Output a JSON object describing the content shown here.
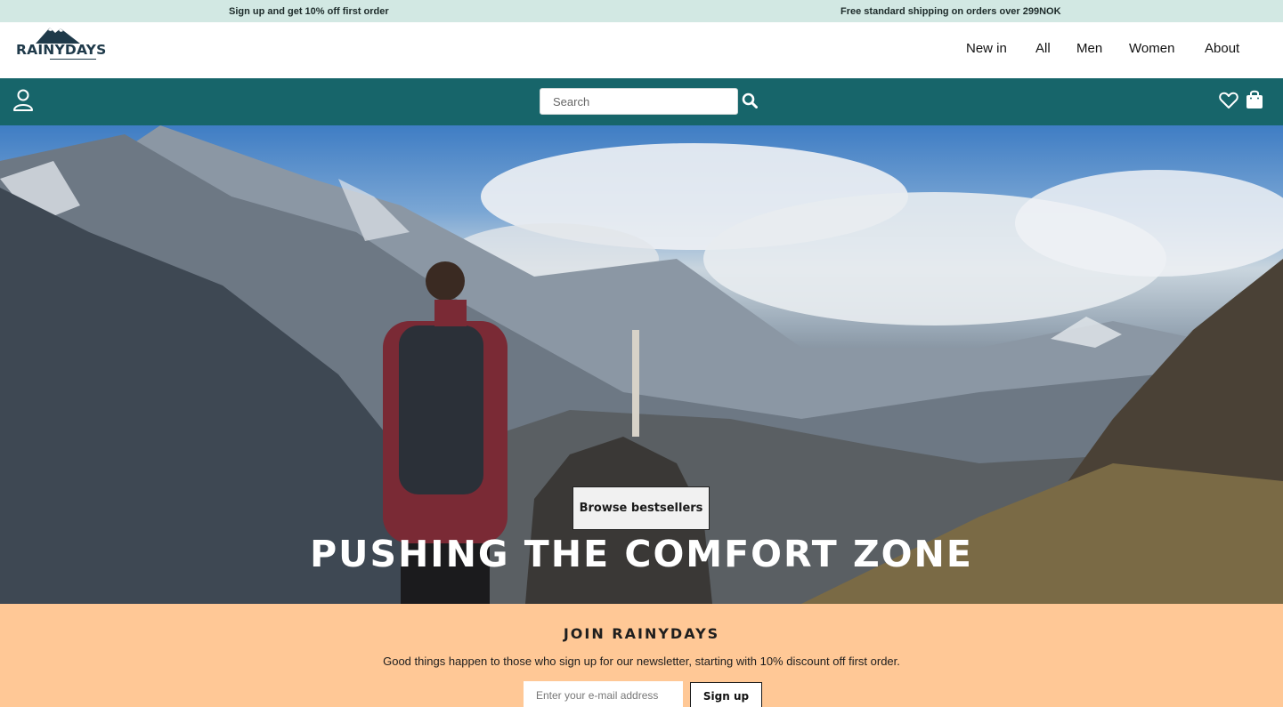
{
  "promo": {
    "left": "Sign up and get 10% off first order",
    "right": "Free standard shipping on orders over 299NOK"
  },
  "header": {
    "logo_text": "RAINYDAYS",
    "nav": [
      "New in",
      "All",
      "Men",
      "Women",
      "About"
    ]
  },
  "toolbar": {
    "search_placeholder": "Search",
    "icons": [
      "user-icon",
      "search-icon",
      "heart-icon",
      "shopping-bag-icon"
    ]
  },
  "hero": {
    "title": "PUSHING THE COMFORT ZONE",
    "button_label": "Browse bestsellers"
  },
  "newsletter": {
    "title": "JOIN RAINYDAYS",
    "text": "Good things happen to those who sign up for our newsletter, starting with 10% discount off first order.",
    "email_placeholder": "Enter your e-mail address",
    "button_label": "Sign up"
  },
  "colors": {
    "promo_bg": "#d2e8e3",
    "toolbar_bg": "#17656a",
    "newsletter_bg": "#ffc896"
  }
}
